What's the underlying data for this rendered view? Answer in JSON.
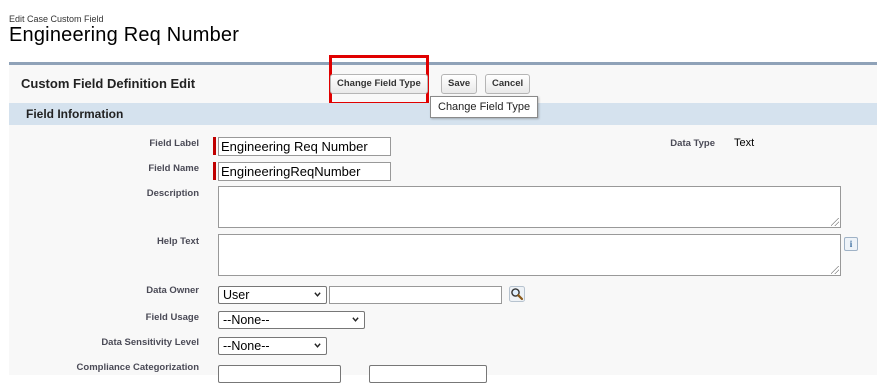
{
  "header": {
    "breadcrumb": "Edit Case Custom Field",
    "title": "Engineering Req Number"
  },
  "panel": {
    "title": "Custom Field Definition Edit",
    "buttons": {
      "change_type": "Change Field Type",
      "save": "Save",
      "cancel": "Cancel"
    },
    "tooltip": "Change Field Type",
    "section_title": "Field Information"
  },
  "fields": {
    "field_label": {
      "label": "Field Label",
      "value": "Engineering Req Number"
    },
    "field_name": {
      "label": "Field Name",
      "value": "EngineeringReqNumber"
    },
    "description": {
      "label": "Description",
      "value": ""
    },
    "help_text": {
      "label": "Help Text",
      "value": ""
    },
    "data_owner": {
      "label": "Data Owner",
      "selected": "User",
      "value": ""
    },
    "field_usage": {
      "label": "Field Usage",
      "selected": "--None--"
    },
    "data_sensitivity": {
      "label": "Data Sensitivity Level",
      "selected": "--None--"
    },
    "compliance": {
      "label": "Compliance Categorization"
    }
  },
  "data_type": {
    "label": "Data Type",
    "value": "Text"
  },
  "icons": {
    "info": "info-icon",
    "lookup": "lookup-magnifier-icon"
  },
  "colors": {
    "highlight": "#e00000",
    "required_bar": "#c00000",
    "section_bg": "#d5e2ee",
    "panel_border": "#8fa2b8"
  }
}
